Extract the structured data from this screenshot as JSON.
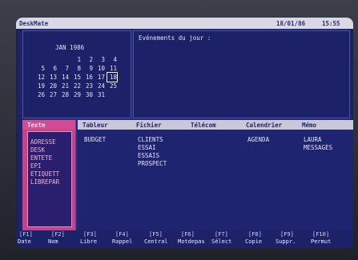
{
  "app": {
    "title": "DeskMate",
    "date": "18/01/86",
    "time": "15:55"
  },
  "calendar": {
    "month_label": "JAN 1986",
    "rows": [
      [
        "",
        "",
        "",
        "",
        "1",
        "2",
        "3",
        "4"
      ],
      [
        "5",
        "6",
        "7",
        "8",
        "9",
        "10",
        "11"
      ],
      [
        "12",
        "13",
        "14",
        "15",
        "16",
        "17",
        "18"
      ],
      [
        "19",
        "20",
        "21",
        "22",
        "23",
        "24",
        "25"
      ],
      [
        "26",
        "27",
        "28",
        "29",
        "30",
        "31"
      ]
    ],
    "today": "18"
  },
  "events": {
    "title": "Evénements du jour :"
  },
  "columns": [
    {
      "title": "Texte",
      "items": [
        "ADRESSE",
        "DESK",
        "ENTETE",
        "EPI",
        "ETIQUETT",
        "LIBREPAR"
      ]
    },
    {
      "title": "Tableur",
      "items": [
        "BUDGET"
      ]
    },
    {
      "title": "Fichier",
      "items": [
        "CLIENTS",
        "ESSAI",
        "ESSAIS",
        "PROSPECT"
      ]
    },
    {
      "title": "Télécom",
      "items": []
    },
    {
      "title": "Calendrier",
      "items": [
        "AGENDA"
      ]
    },
    {
      "title": "Mémo",
      "items": [
        "LAURA",
        "MESSAGES"
      ]
    }
  ],
  "fkeys": [
    {
      "key": "[F1]",
      "label": "Date"
    },
    {
      "key": "[F2]",
      "label": "Nom"
    },
    {
      "key": "[F3]",
      "label": "Libre"
    },
    {
      "key": "[F4]",
      "label": "Rappel"
    },
    {
      "key": "[F5]",
      "label": "Central"
    },
    {
      "key": "[F6]",
      "label": "Motdepas"
    },
    {
      "key": "[F7]",
      "label": "Sélect"
    },
    {
      "key": "[F8]",
      "label": "Copie"
    },
    {
      "key": "[F9]",
      "label": "Suppr."
    },
    {
      "key": "[F10]",
      "label": "Permut"
    }
  ],
  "colors": {
    "screen": "#262b78",
    "selected": "#c9418a",
    "header": "#c8c8d8"
  }
}
